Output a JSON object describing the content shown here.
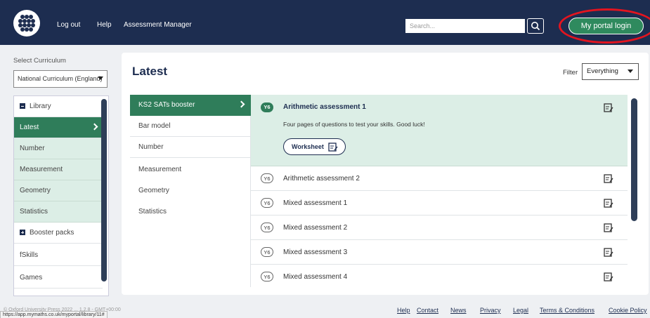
{
  "header": {
    "nav": [
      "Log out",
      "Help",
      "Assessment Manager"
    ],
    "search_placeholder": "Search...",
    "portal_login": "My portal login"
  },
  "sidebar": {
    "curriculum_label": "Select Curriculum",
    "curriculum_value": "National Curriculum (England)",
    "items": [
      {
        "label": "Library",
        "type": "parent"
      },
      {
        "label": "Latest",
        "type": "active"
      },
      {
        "label": "Number",
        "type": "sub"
      },
      {
        "label": "Measurement",
        "type": "sub"
      },
      {
        "label": "Geometry",
        "type": "sub"
      },
      {
        "label": "Statistics",
        "type": "sub"
      },
      {
        "label": "Booster packs",
        "type": "parent"
      },
      {
        "label": "fSkills",
        "type": "plain"
      },
      {
        "label": "Games",
        "type": "plain"
      }
    ]
  },
  "main": {
    "title": "Latest",
    "filter_label": "Filter",
    "filter_value": "Everything",
    "categories": [
      "KS2 SATs booster",
      "Bar model",
      "Number",
      "Measurement",
      "Geometry",
      "Statistics"
    ],
    "featured": {
      "badge": "Y6",
      "title": "Arithmetic assessment 1",
      "description": "Four pages of questions to test your skills. Good luck!",
      "worksheet_label": "Worksheet"
    },
    "resources": [
      {
        "badge": "Y6",
        "title": "Arithmetic assessment 2"
      },
      {
        "badge": "Y6",
        "title": "Mixed assessment 1"
      },
      {
        "badge": "Y6",
        "title": "Mixed assessment 2"
      },
      {
        "badge": "Y6",
        "title": "Mixed assessment 3"
      },
      {
        "badge": "Y6",
        "title": "Mixed assessment 4"
      }
    ]
  },
  "footer": {
    "copyright": "© Oxford University Press 2022 ... 1.2.8 - GMT+00:00",
    "status_url": "https://app.mymaths.co.uk/myportal/library/11#",
    "links": [
      "Help",
      "Contact",
      "News",
      "Privacy",
      "Legal",
      "Terms & Conditions",
      "Cookie Policy"
    ]
  },
  "colors": {
    "header_bg": "#1d2d50",
    "accent_green": "#2f7d5a",
    "light_green": "#dceee6",
    "annotation_red": "#e3141f"
  }
}
